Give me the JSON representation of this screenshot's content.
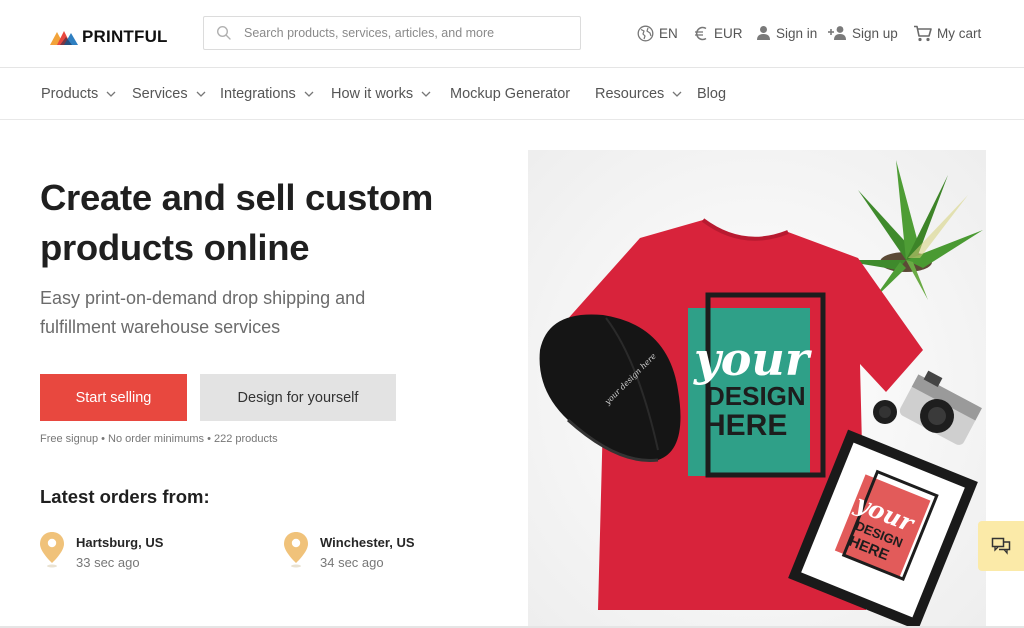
{
  "header": {
    "logo_text": "PRINTFUL",
    "search_placeholder": "Search products, services, articles, and more",
    "language": "EN",
    "currency": "EUR",
    "sign_in": "Sign in",
    "sign_up": "Sign up",
    "cart": "My cart"
  },
  "nav": {
    "items": [
      {
        "label": "Products",
        "dropdown": true
      },
      {
        "label": "Services",
        "dropdown": true
      },
      {
        "label": "Integrations",
        "dropdown": true
      },
      {
        "label": "How it works",
        "dropdown": true
      },
      {
        "label": "Mockup Generator",
        "dropdown": false
      },
      {
        "label": "Resources",
        "dropdown": true
      },
      {
        "label": "Blog",
        "dropdown": false
      }
    ]
  },
  "hero": {
    "headline_line1": "Create and sell custom",
    "headline_line2": "products online",
    "sub_line1": "Easy print-on-demand drop shipping and",
    "sub_line2": "fulfillment warehouse services",
    "primary_button": "Start selling",
    "secondary_button": "Design for yourself",
    "perks": "Free signup • No order minimums • 222 products",
    "image": {
      "tshirt_text_1": "your",
      "tshirt_text_2": "DESIGN",
      "tshirt_text_3": "HERE"
    }
  },
  "orders": {
    "title": "Latest orders from:",
    "items": [
      {
        "city": "Hartsburg, US",
        "ago": "33 sec ago"
      },
      {
        "city": "Winchester, US",
        "ago": "34 sec ago"
      }
    ]
  },
  "colors": {
    "accent": "#e8483f",
    "pin": "#f0c27a",
    "chat_bg": "#fbeaa8",
    "tshirt": "#d8233b",
    "design_teal": "#2fa088"
  },
  "icons": {
    "search": "search-icon",
    "globe": "globe-icon",
    "euro": "euro-icon",
    "user": "user-icon",
    "add_user": "add-user-icon",
    "cart": "cart-icon",
    "chevron": "chevron-down-icon",
    "pin": "location-pin-icon",
    "chat": "chat-icon"
  }
}
